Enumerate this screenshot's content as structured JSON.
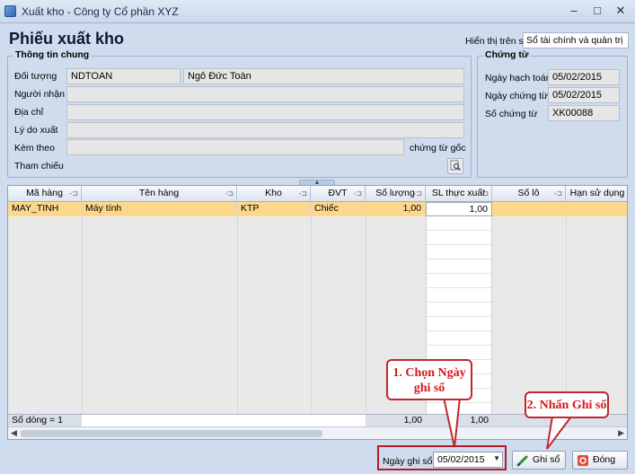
{
  "window": {
    "title": "Xuất kho - Công ty Cổ phần XYZ",
    "minimize": "–",
    "maximize": "□",
    "close": "✕"
  },
  "page_title": "Phiếu xuất kho",
  "display": {
    "label": "Hiển thị trên sổ",
    "value": "Sổ tài chính và quản trị"
  },
  "general_info": {
    "title": "Thông tin chung",
    "object_label": "Đối tượng",
    "object_code": "NDTOAN",
    "object_name": "Ngô Đức Toàn",
    "receiver_label": "Người nhận",
    "receiver": "",
    "address_label": "Địa chỉ",
    "address": "",
    "reason_label": "Lý do xuất",
    "reason": "",
    "attach_label": "Kèm theo",
    "attach": "",
    "orig_doc_label": "chứng từ gốc",
    "reference_label": "Tham chiếu",
    "reference_icon": "search-document-icon"
  },
  "voucher": {
    "title": "Chứng từ",
    "posting_date_label": "Ngày hạch toán",
    "posting_date": "05/02/2015",
    "voucher_date_label": "Ngày chứng từ",
    "voucher_date": "05/02/2015",
    "voucher_no_label": "Số chứng từ",
    "voucher_no": "XK00088"
  },
  "grid": {
    "columns": [
      "Mã hàng",
      "Tên hàng",
      "Kho",
      "ĐVT",
      "Số lượng",
      "SL thực xuất",
      "Số lô",
      "Hạn sử dụng"
    ],
    "rows": [
      [
        "MAY_TINH",
        "Máy tính",
        "KTP",
        "Chiếc",
        "1,00",
        "1,00",
        "",
        ""
      ]
    ],
    "footer": {
      "count": "Số dòng = 1",
      "qty_total": "1,00",
      "actual_total": "1,00"
    }
  },
  "callouts": {
    "step1": "1. Chọn Ngày ghi sổ",
    "step2": "2. Nhấn Ghi sổ"
  },
  "bottom": {
    "record_date_label": "Ngày ghi sổ",
    "record_date": "05/02/2015",
    "post_button": "Ghi sổ",
    "close_button": "Đóng"
  },
  "colors": {
    "selected_row": "#fdd88c",
    "callout_red": "#c0282d",
    "background": "#cfdcee"
  }
}
